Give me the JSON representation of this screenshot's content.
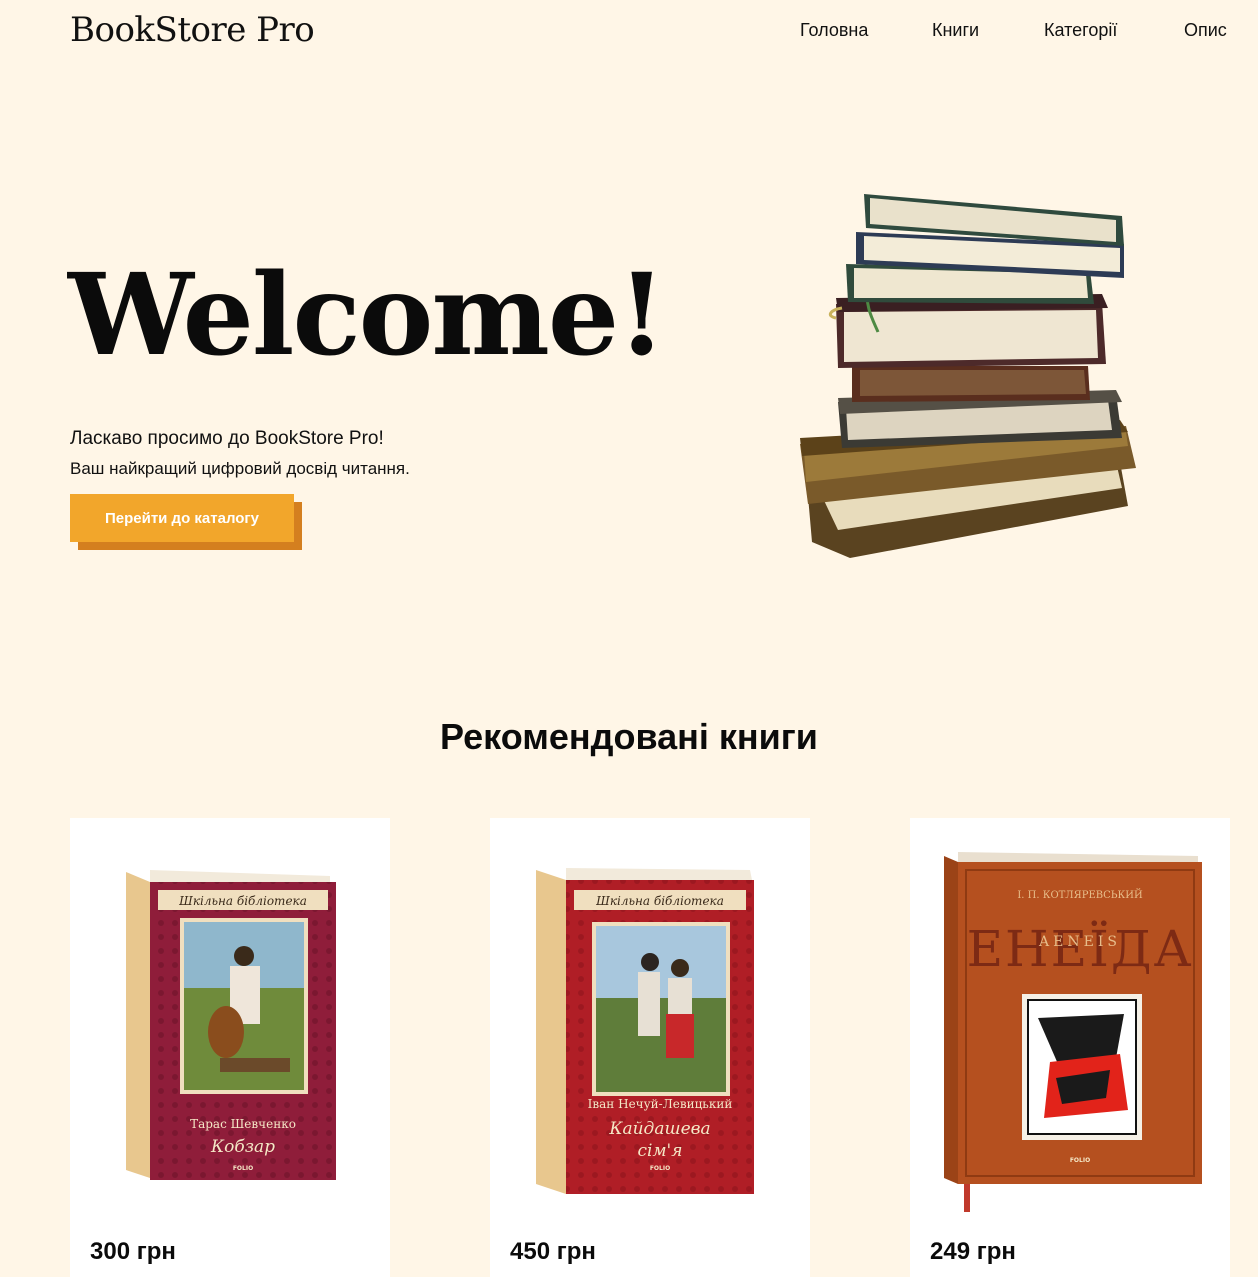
{
  "header": {
    "logo": "BookStore Pro",
    "nav": [
      "Головна",
      "Книги",
      "Категорії",
      "Опис"
    ]
  },
  "hero": {
    "title": "Welcome!",
    "subtitle_line1": "Ласкаво просимо до BookStore Pro!",
    "subtitle_line2": "Ваш найкращий цифровий досвід читання.",
    "cta_label": "Перейти до каталогу"
  },
  "recommended": {
    "title": "Рекомендовані книги",
    "books": [
      {
        "series": "Шкільна бібліотека",
        "author": "Тарас Шевченко",
        "title": "Кобзар",
        "publisher": "FOLIO",
        "price": "300 грн",
        "cover_color": "#8f1d3a"
      },
      {
        "series": "Шкільна бібліотека",
        "author": "Іван Нечуй-Левицький",
        "title_line1": "Кайдашева",
        "title_line2": "сім'я",
        "publisher": "FOLIO",
        "price": "450 грн",
        "cover_color": "#b01e26"
      },
      {
        "author": "І. П. КОТЛЯРЕВСЬКИЙ",
        "title": "ЕНЕЇДА",
        "title_overlay": "AENEIS",
        "publisher": "FOLIO",
        "price": "249 грн",
        "cover_color": "#b5501f"
      }
    ]
  },
  "colors": {
    "background": "#fff6e7",
    "accent": "#f2a62b",
    "accent_shadow": "#d47f1f"
  }
}
